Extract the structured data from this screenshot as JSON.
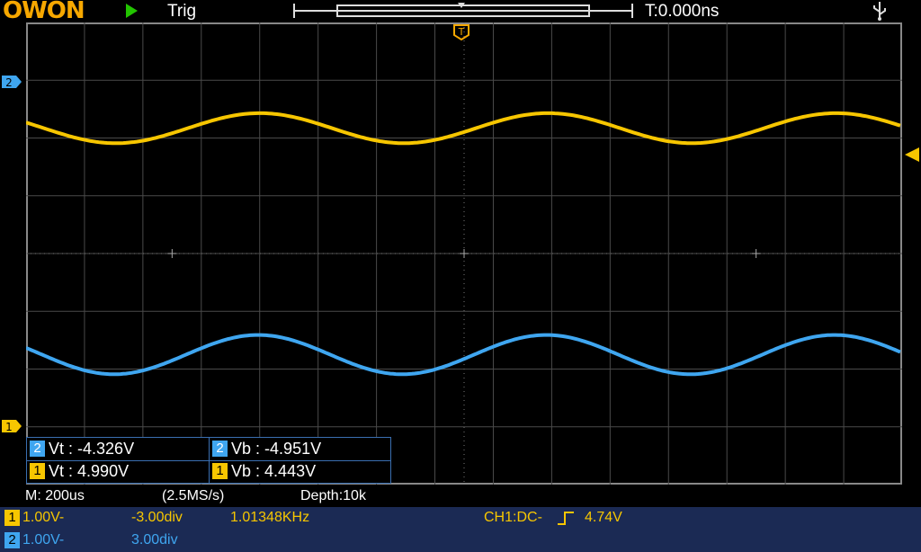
{
  "header": {
    "brand": "OWON",
    "run_state": "Trig",
    "time_offset": "T:0.000ns"
  },
  "colors": {
    "ch1": "#f7c600",
    "ch2": "#3fa6f0",
    "grid": "#4a4a4a",
    "panel": "#1b2a54"
  },
  "markers": {
    "ch2_marker": "2",
    "ch1_marker": "1",
    "trigger_pos": "T"
  },
  "measurements": [
    {
      "channel": "2",
      "label": "Vt",
      "value": ": -4.326V"
    },
    {
      "channel": "2",
      "label": "Vb",
      "value": ": -4.951V"
    },
    {
      "channel": "1",
      "label": "Vt",
      "value": ": 4.990V"
    },
    {
      "channel": "1",
      "label": "Vb",
      "value": ": 4.443V"
    }
  ],
  "status": {
    "timebase": "M: 200us",
    "sample_rate": "(2.5MS/s)",
    "depth": "Depth:10k"
  },
  "channels": [
    {
      "id": "1",
      "scale": "1.00V-",
      "offset": "-3.00div",
      "frequency": "1.01348KHz",
      "trigger": "CH1:DC-",
      "trigger_level": "4.74V"
    },
    {
      "id": "2",
      "scale": "1.00V-",
      "offset": "3.00div"
    }
  ],
  "waveforms": {
    "period_ms": 0.9867,
    "ch1": {
      "max_v": 4.99,
      "min_v": 4.443
    },
    "ch2": {
      "max_v": -4.326,
      "min_v": -4.951
    }
  }
}
